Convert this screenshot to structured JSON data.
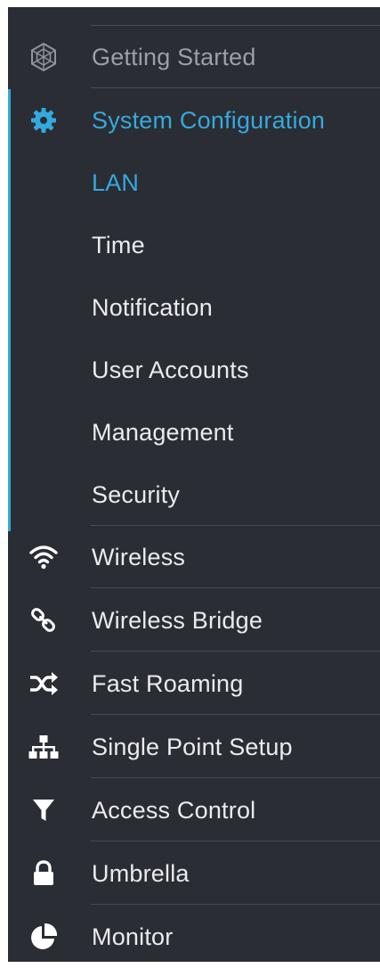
{
  "colors": {
    "sidebar_bg": "#2a2d33",
    "accent": "#35a9df",
    "text": "#e9ebee",
    "muted": "#9aa0a7",
    "divider": "#474b52"
  },
  "nav": {
    "getting_started": {
      "label": "Getting Started",
      "icon": "cisco-hexagon-icon"
    },
    "system_configuration": {
      "label": "System Configuration",
      "icon": "gear-icon",
      "subitems": [
        {
          "label": "LAN",
          "active": true
        },
        {
          "label": "Time"
        },
        {
          "label": "Notification"
        },
        {
          "label": "User Accounts"
        },
        {
          "label": "Management"
        },
        {
          "label": "Security"
        }
      ]
    },
    "wireless": {
      "label": "Wireless",
      "icon": "wifi-icon"
    },
    "wireless_bridge": {
      "label": "Wireless Bridge",
      "icon": "link-icon"
    },
    "fast_roaming": {
      "label": "Fast Roaming",
      "icon": "shuffle-icon"
    },
    "single_point_setup": {
      "label": "Single Point Setup",
      "icon": "network-hierarchy-icon"
    },
    "access_control": {
      "label": "Access Control",
      "icon": "filter-icon"
    },
    "umbrella": {
      "label": "Umbrella",
      "icon": "lock-icon"
    },
    "monitor": {
      "label": "Monitor",
      "icon": "pie-chart-icon"
    }
  }
}
